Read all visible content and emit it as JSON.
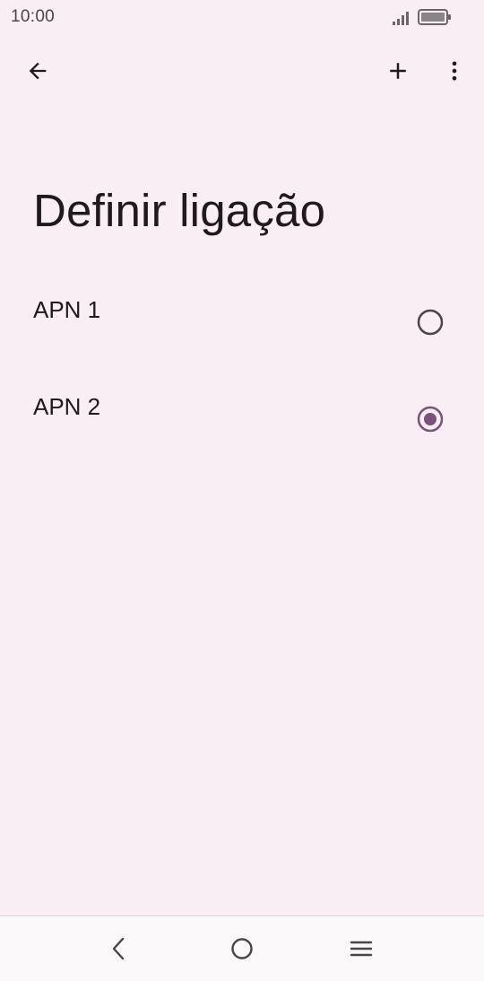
{
  "status_bar": {
    "time": "10:00",
    "signal_icon": "signal-icon",
    "battery_icon": "battery-icon"
  },
  "toolbar": {
    "back_icon": "arrow-back-icon",
    "add_icon": "plus-icon",
    "more_icon": "more-vert-icon"
  },
  "page": {
    "title": "Definir ligação"
  },
  "apns": [
    {
      "label": "APN 1",
      "selected": false
    },
    {
      "label": "APN 2",
      "selected": true
    }
  ],
  "colors": {
    "background": "#f9eef3",
    "accent": "#7d4f7d",
    "radio_unselected": "#4a4448"
  },
  "nav_bar": {
    "back_icon": "nav-back-icon",
    "home_icon": "nav-home-icon",
    "recents_icon": "nav-recents-icon"
  }
}
